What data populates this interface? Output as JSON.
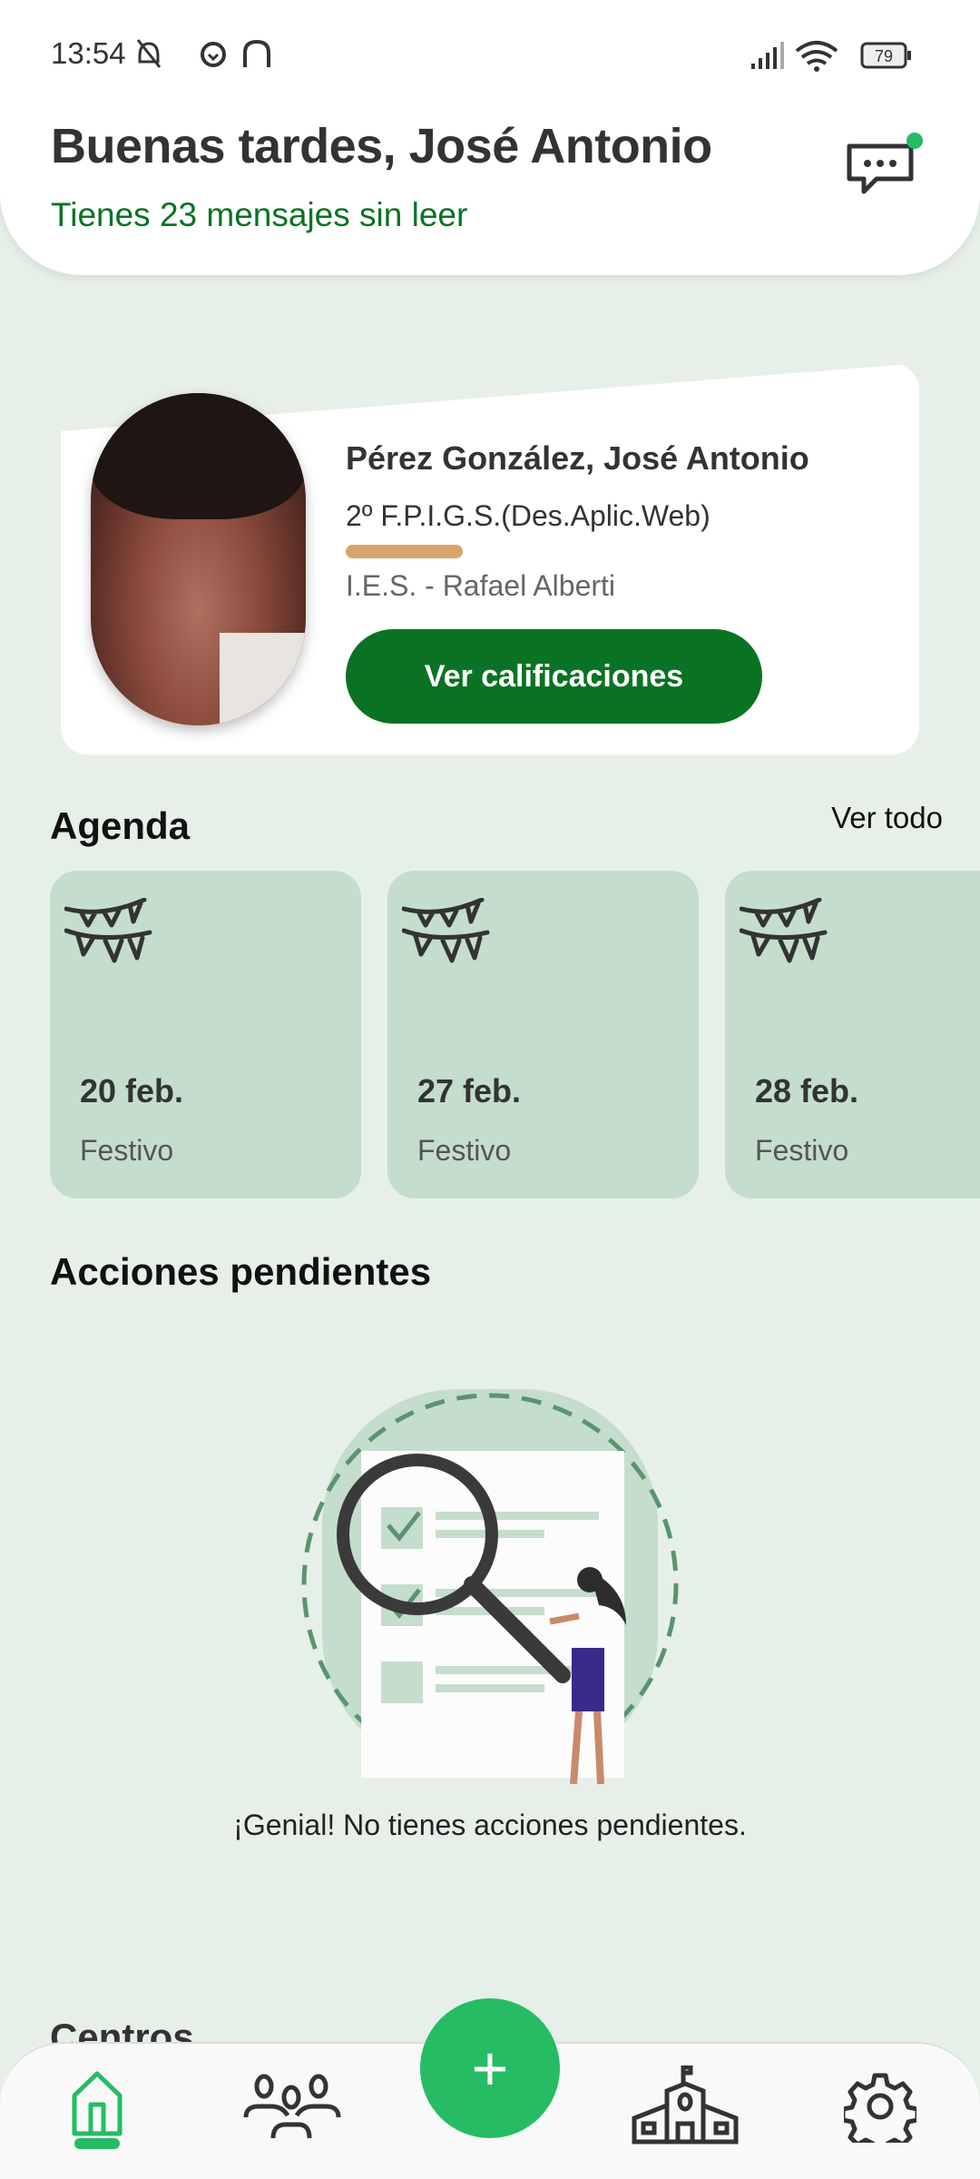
{
  "status_bar": {
    "time": "13:54",
    "battery": "79"
  },
  "header": {
    "title": "Buenas tardes, José Antonio",
    "subtitle": "Tienes 23 mensajes sin leer"
  },
  "profile": {
    "name": "Pérez González, José Antonio",
    "course": "2º F.P.I.G.S.(Des.Aplic.Web)",
    "school": "I.E.S. - Rafael Alberti",
    "button": "Ver calificaciones"
  },
  "agenda": {
    "title": "Agenda",
    "see_all": "Ver todo",
    "events": [
      {
        "date": "20 feb.",
        "type": "Festivo"
      },
      {
        "date": "27 feb.",
        "type": "Festivo"
      },
      {
        "date": "28 feb.",
        "type": "Festivo"
      }
    ]
  },
  "pending": {
    "title": "Acciones pendientes",
    "empty_text": "¡Genial! No tienes acciones pendientes."
  },
  "centers": {
    "title": "Centros"
  },
  "nav": {
    "items": [
      "home",
      "students",
      "add",
      "school",
      "settings"
    ],
    "active": "home",
    "accent": "#25bc63"
  },
  "colors": {
    "primary": "#0a7323",
    "accent": "#25bc63",
    "background": "#e6f0e8",
    "card": "#c5ddcc"
  }
}
